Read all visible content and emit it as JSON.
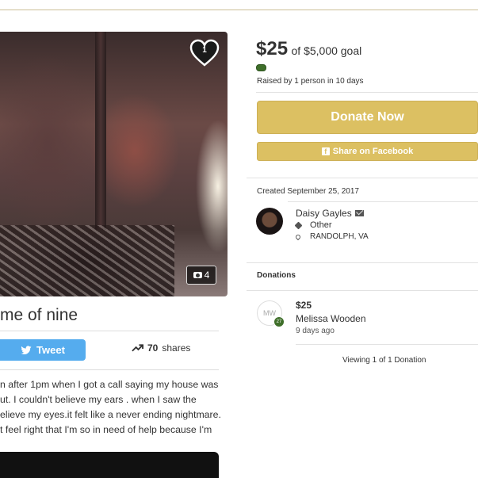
{
  "campaign": {
    "title": "me of nine",
    "photo_count": "4",
    "likes": "1",
    "story_lines": [
      "n after 1pm when I got a call saying my house was",
      "ut. I couldn't believe my ears . when I saw the",
      "elieve my eyes.it felt like a never ending nightmare.",
      "t feel right that I'm so in need of help because I'm"
    ]
  },
  "share": {
    "tweet_label": "Tweet",
    "shares_count": "70",
    "shares_label": "shares"
  },
  "funding": {
    "amount": "$25",
    "goal_text": "of $5,000 goal",
    "progress_fraction": 0.005,
    "raised_text": "Raised by 1 person in 10 days",
    "donate_label": "Donate Now",
    "facebook_label": "Share on Facebook"
  },
  "organizer": {
    "created_text": "Created September 25, 2017",
    "name": "Daisy Gayles",
    "category": "Other",
    "location": "RANDOLPH, VA"
  },
  "donations": {
    "heading": "Donations",
    "items": [
      {
        "initials": "MW",
        "badge": "27",
        "amount": "$25",
        "name": "Melissa Wooden",
        "time": "9 days ago"
      }
    ],
    "viewing_text": "Viewing 1 of 1 Donation"
  },
  "colors": {
    "accent_gold": "#dcc062",
    "progress_green": "#3f6f2a",
    "twitter_blue": "#55acee"
  },
  "icons": [
    "heart-icon",
    "camera-icon",
    "twitter-bird-icon",
    "trending-up-icon",
    "facebook-icon",
    "mail-icon",
    "tag-icon",
    "location-pin-icon"
  ]
}
